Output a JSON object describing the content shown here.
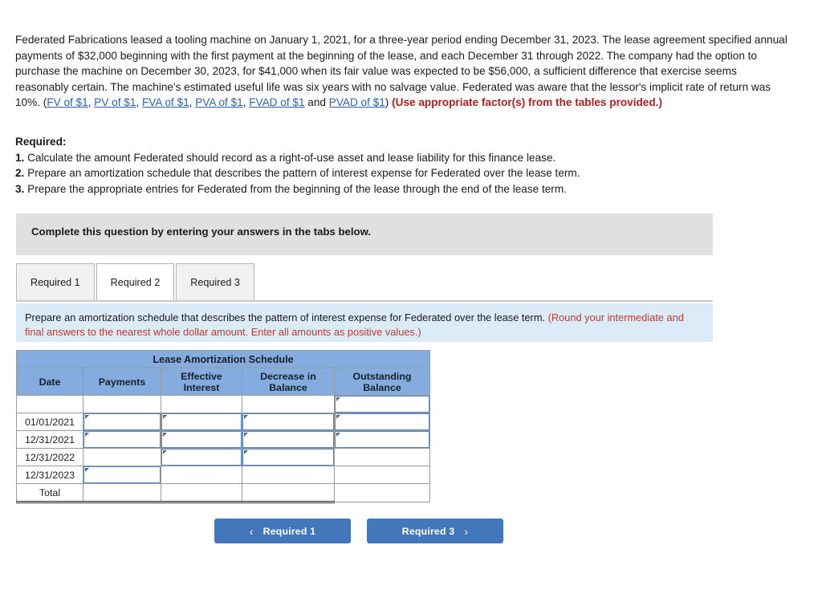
{
  "problem": {
    "segments": [
      {
        "type": "text",
        "value": "Federated Fabrications leased a tooling machine on January 1, 2021, for a three-year period ending December 31, 2023. The lease agreement specified annual payments of $32,000 beginning with the first payment at the beginning of the lease, and each December 31 through 2022. The company had the option to purchase the machine on December 30, 2023, for $41,000 when its fair value was expected to be $56,000, a sufficient difference that exercise seems reasonably certain. The machine's estimated useful life was six years with no salvage value. Federated was aware that the lessor's implicit rate of return was 10%. ("
      },
      {
        "type": "link",
        "value": "FV of $1"
      },
      {
        "type": "text",
        "value": ", "
      },
      {
        "type": "link",
        "value": "PV of $1"
      },
      {
        "type": "text",
        "value": ", "
      },
      {
        "type": "link",
        "value": "FVA of $1"
      },
      {
        "type": "text",
        "value": ", "
      },
      {
        "type": "link",
        "value": "PVA of $1"
      },
      {
        "type": "text",
        "value": ", "
      },
      {
        "type": "link",
        "value": "FVAD of $1"
      },
      {
        "type": "text",
        "value": " and "
      },
      {
        "type": "link",
        "value": "PVAD of $1"
      },
      {
        "type": "text",
        "value": ") "
      },
      {
        "type": "bold-red",
        "value": "(Use appropriate factor(s) from the tables provided.)"
      }
    ],
    "link_color": "#2a62ad",
    "emphasis_color": "#b02020"
  },
  "required": {
    "heading": "Required:",
    "items": [
      {
        "num": "1.",
        "text": "Calculate the amount Federated should record as a right-of-use asset and lease liability for this finance lease."
      },
      {
        "num": "2.",
        "text": "Prepare an amortization schedule that describes the pattern of interest expense for Federated over the lease term."
      },
      {
        "num": "3.",
        "text": "Prepare the appropriate entries for Federated from the beginning of the lease through the end of the lease term."
      }
    ]
  },
  "instruction_bar": {
    "text": "Complete this question by entering your answers in the tabs below.",
    "background": "#e0e0e0"
  },
  "tabs": {
    "items": [
      {
        "label": "Required 1",
        "active": false
      },
      {
        "label": "Required 2",
        "active": true
      },
      {
        "label": "Required 3",
        "active": false
      }
    ]
  },
  "tab_instruction": {
    "main": "Prepare an amortization schedule that describes the pattern of interest expense for Federated over the lease term.",
    "note": "(Round your intermediate and final answers to the nearest whole dollar amount. Enter all amounts as positive values.)",
    "background": "#dcebf8",
    "note_color": "#c23b2b"
  },
  "amortization_table": {
    "title": "Lease Amortization Schedule",
    "header_background": "#85acdf",
    "columns": [
      "Date",
      "Payments",
      "Effective Interest",
      "Decrease in Balance",
      "Outstanding Balance"
    ],
    "column_headers": [
      {
        "line1": "Date",
        "line2": ""
      },
      {
        "line1": "Payments",
        "line2": ""
      },
      {
        "line1": "Effective",
        "line2": "Interest"
      },
      {
        "line1": "Decrease in",
        "line2": "Balance"
      },
      {
        "line1": "Outstanding",
        "line2": "Balance"
      }
    ],
    "rows": [
      {
        "date": "",
        "payments": "",
        "effective_interest": "",
        "decrease_in_balance": "",
        "outstanding_balance": "",
        "inputs": [
          false,
          false,
          false,
          false,
          true
        ]
      },
      {
        "date": "01/01/2021",
        "payments": "",
        "effective_interest": "",
        "decrease_in_balance": "",
        "outstanding_balance": "",
        "inputs": [
          false,
          true,
          true,
          true,
          true
        ]
      },
      {
        "date": "12/31/2021",
        "payments": "",
        "effective_interest": "",
        "decrease_in_balance": "",
        "outstanding_balance": "",
        "inputs": [
          false,
          true,
          true,
          true,
          true
        ]
      },
      {
        "date": "12/31/2022",
        "payments": "",
        "effective_interest": "",
        "decrease_in_balance": "",
        "outstanding_balance": "",
        "inputs": [
          false,
          false,
          true,
          true,
          false
        ]
      },
      {
        "date": "12/31/2023",
        "payments": "",
        "effective_interest": "",
        "decrease_in_balance": "",
        "outstanding_balance": "",
        "inputs": [
          false,
          true,
          false,
          false,
          false
        ]
      },
      {
        "date": "Total",
        "payments": "",
        "effective_interest": "",
        "decrease_in_balance": "",
        "outstanding_balance": "",
        "inputs": [
          false,
          false,
          false,
          false,
          false
        ],
        "is_total": true
      }
    ]
  },
  "navigation": {
    "prev_label": "Required 1",
    "next_label": "Required 3",
    "prev_icon": "chevron-left-icon",
    "next_icon": "chevron-right-icon",
    "prev_chevron": "‹",
    "next_chevron": "›",
    "button_color": "#4277bb"
  }
}
